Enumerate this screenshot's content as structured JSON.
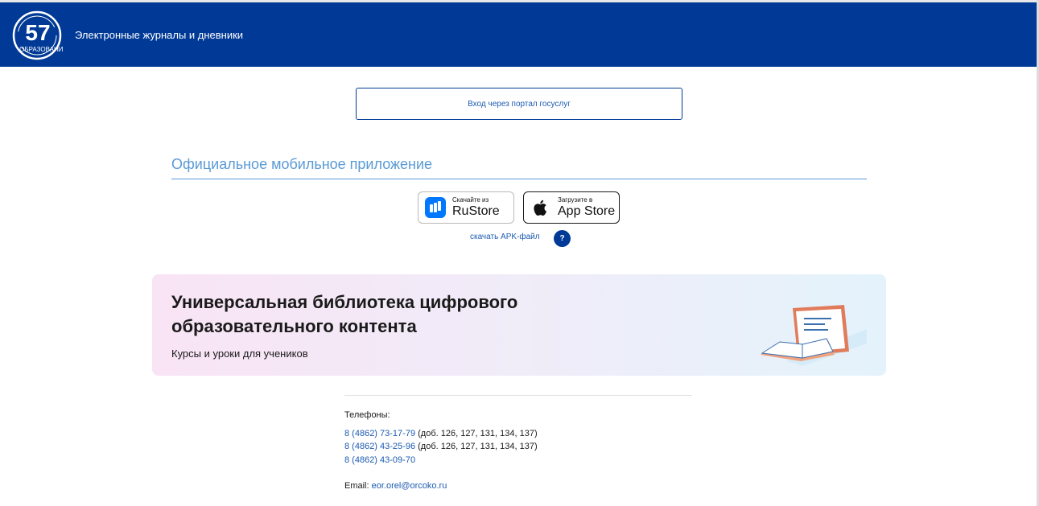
{
  "header": {
    "logo_number": "57",
    "logo_caption": "ОБРАЗОВАНИЕ",
    "title": "Электронные журналы и дневники",
    "bg_color": "#003a96"
  },
  "login": {
    "gosuslugi_label": "Вход через портал госуслуг"
  },
  "mobile_app": {
    "title": "Официальное мобильное приложение",
    "rustore": {
      "small": "Скачайте из",
      "big": "RuStore",
      "icon": "rustore-icon"
    },
    "appstore": {
      "small": "Загрузите в",
      "big": "App Store",
      "icon": "apple-icon"
    },
    "apk_label": "скачать APK-файл",
    "help_label": "?"
  },
  "banner": {
    "title": "Универсальная библиотека цифрового образовательного контента",
    "subtitle": "Курсы и уроки для учеников",
    "icon": "laptop-book-icon"
  },
  "contacts": {
    "phones_label": "Телефоны:",
    "phones": [
      {
        "number": "8 (4862) 73-17-79",
        "ext": " (доб. 126, 127, 131, 134, 137)"
      },
      {
        "number": "8 (4862) 43-25-96",
        "ext": " (доб. 126, 127, 131, 134, 137)"
      },
      {
        "number": "8 (4862) 43-09-70",
        "ext": ""
      }
    ],
    "email_label": "Email: ",
    "email": "eor.orel@orcoko.ru"
  }
}
